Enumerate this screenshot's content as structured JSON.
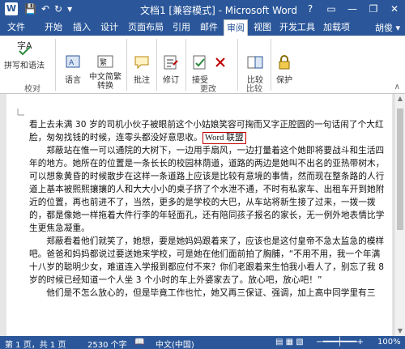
{
  "title_bar": {
    "logo_letter": "W",
    "qat_icons": [
      "save-icon",
      "undo-icon",
      "redo-icon",
      "customize-icon"
    ],
    "qat_glyphs": [
      "💾",
      "↶",
      "↻",
      "▾"
    ],
    "title": "文档1 [兼容模式] - Microsoft Word",
    "window_controls": [
      "?",
      "▭",
      "—",
      "❐",
      "✕"
    ]
  },
  "tabs": {
    "items": [
      "文件",
      "开始",
      "插入",
      "设计",
      "页面布局",
      "引用",
      "邮件",
      "审阅",
      "视图",
      "开发工具",
      "加载项"
    ],
    "active": "审阅",
    "user": "胡俊 ▾"
  },
  "ribbon": {
    "proofing": {
      "spelling_label": "拼写和语法",
      "group_label": "校对"
    },
    "language_label": "语言",
    "chinese_convert_label": "中文简繁转换",
    "comment_label": "批注",
    "track_label": "修订",
    "accept_label": "接受",
    "changes_group_label": "更改",
    "compare_label": "比较",
    "compare_group_label": "比较",
    "protect_label": "保护",
    "collapse_glyph": "∧"
  },
  "document": {
    "paragraphs": [
      {
        "text": "看上去未满 30 岁的司机小伙子被眼前这个小姑娘笑容可掬而又字正腔圆的一句话闹了个大红脸，匆匆找钱的时候，连零头都没好意思收。",
        "comment": "Word 联盟"
      },
      {
        "text": "郑蔽站在惟一可以通院的大树下，一边用手扇风，一边打量着这个她即将要战斗和生活四年的地方。她所在的位置是一条长长的校园林荫道，道路的两边是她叫不出名的亚热带树木，可以想象黄昏的时候散步在这样一条道路上应该是比较有意境的事情，然而现在整条路的人行道上基本被熙熙攘攘的人和大大小小的桌子挤了个水泄不通，不时有私家车、出租车开到她附近的位置，再也前进不了，当然，更多的是学校的大巴，从车站将新生接了过来，一拨一拨的，都是像她一样拖着大件行李的年轻面孔，还有陪同孩子报名的家长，无一例外地表情比学生更焦急凝重。",
        "comment": ""
      },
      {
        "text": "郑蔽看着他们就笑了，她想，要是她妈妈跟着来了，应该也是这付皇帝不急太监急的模样吧。爸爸和妈妈都说过要送她来学校，可是她在他们面前拍了胸脯，“不用不用，我一个年满十八岁的聪明少女，难道连入学报到都应付不来？你们老跟着来生怕我小看人了，别忘了我 8 岁的时候已经知道一个人坐 3 个小时的车上外婆家去了。放心吧，放心吧！”",
        "comment": ""
      },
      {
        "text": "他们是不怎么放心的，但是毕竟工作也忙，她又再三保证、强调，加上高中同学里有三",
        "comment": ""
      }
    ]
  },
  "status_bar": {
    "page": "第 1 页，共 1 页",
    "word_count": "2530 个字",
    "language": "中文(中国)",
    "zoom": "100%"
  }
}
